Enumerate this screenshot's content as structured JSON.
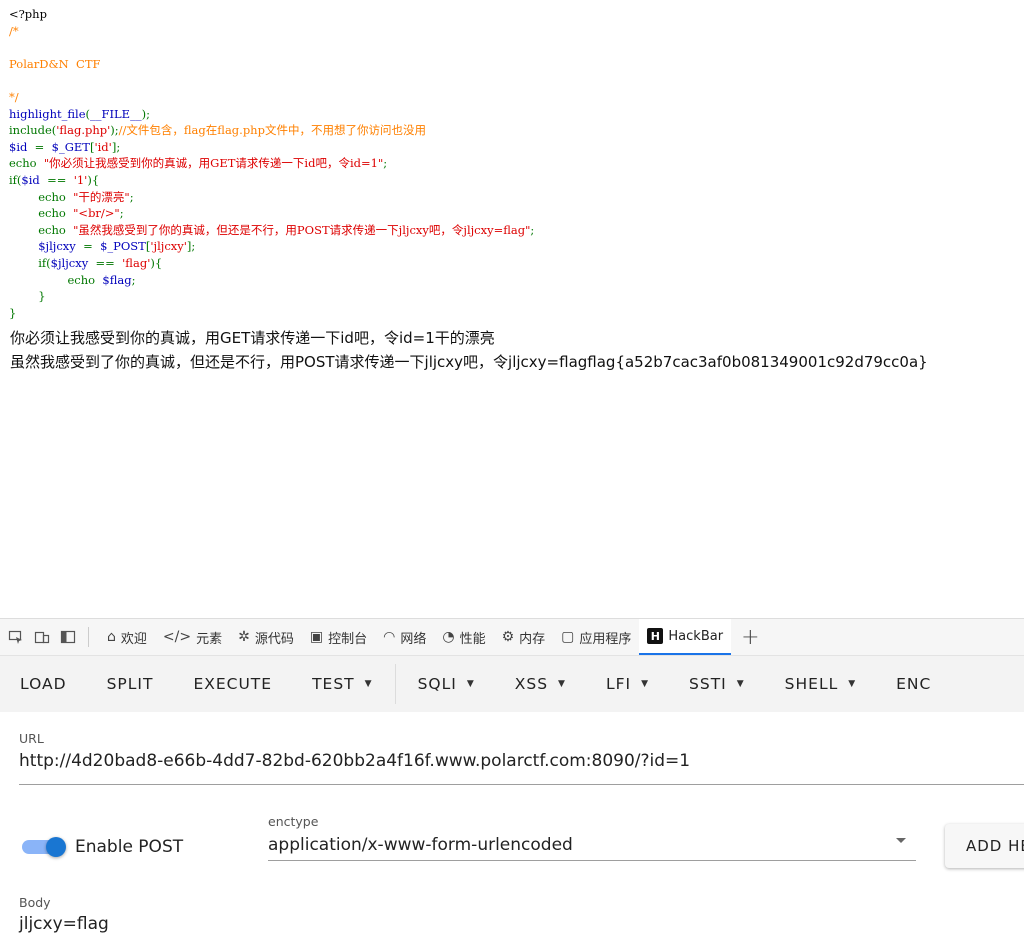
{
  "code": {
    "l1": "<?php",
    "l2": "/*",
    "l4": "PolarD&N  CTF",
    "l6": "*/",
    "l7a": "highlight_file",
    "l7b": "(",
    "l7c": "__FILE__",
    "l7d": ");",
    "l8a": "include(",
    "l8b": "'flag.php'",
    "l8c": ");",
    "l8d": "//文件包含，flag在flag.php文件中，不用想了你访问也没用",
    "l9a": "$id  ",
    "l9b": "=  ",
    "l9c": "$_GET",
    "l9d": "[",
    "l9e": "'id'",
    "l9f": "];",
    "l10a": "echo  ",
    "l10b": "\"你必须让我感受到你的真诚，用GET请求传递一下id吧，令id=1\"",
    "l10c": ";",
    "l11a": "if(",
    "l11b": "$id  ",
    "l11c": "==  ",
    "l11d": "'1'",
    "l11e": "){",
    "l12a": "        echo  ",
    "l12b": "\"干的漂亮\"",
    "l12c": ";",
    "l13a": "        echo  ",
    "l13b": "\"<br/>\"",
    "l13c": ";",
    "l14a": "        echo  ",
    "l14b": "\"虽然我感受到了你的真诚，但还是不行，用POST请求传递一下jljcxy吧，令jljcxy=flag\"",
    "l14c": ";",
    "l15a": "        $jljcxy  ",
    "l15b": "=  ",
    "l15c": "$_POST",
    "l15d": "[",
    "l15e": "'jljcxy'",
    "l15f": "];",
    "l16a": "        if(",
    "l16b": "$jljcxy  ",
    "l16c": "==  ",
    "l16d": "'flag'",
    "l16e": "){",
    "l17a": "                echo  ",
    "l17b": "$flag",
    "l17c": ";",
    "l18": "        }",
    "l19": "}"
  },
  "output": {
    "line1": "你必须让我感受到你的真诚，用GET请求传递一下id吧，令id=1干的漂亮",
    "line2": "虽然我感受到了你的真诚，但还是不行，用POST请求传递一下jljcxy吧，令jljcxy=flagflag{a52b7cac3af0b081349001c92d79cc0a}"
  },
  "devtools": {
    "tabs": [
      {
        "label": "欢迎",
        "icon": "home-icon"
      },
      {
        "label": "元素",
        "icon": "code-icon"
      },
      {
        "label": "源代码",
        "icon": "bug-icon"
      },
      {
        "label": "控制台",
        "icon": "console-icon"
      },
      {
        "label": "网络",
        "icon": "wifi-icon"
      },
      {
        "label": "性能",
        "icon": "performance-icon"
      },
      {
        "label": "内存",
        "icon": "memory-icon"
      },
      {
        "label": "应用程序",
        "icon": "application-icon"
      },
      {
        "label": "HackBar",
        "icon": "hackbar-icon",
        "active": true
      }
    ]
  },
  "hackbar": {
    "buttons": [
      "LOAD",
      "SPLIT",
      "EXECUTE",
      "TEST",
      "SQLI",
      "XSS",
      "LFI",
      "SSTI",
      "SHELL",
      "ENC"
    ],
    "url_label": "URL",
    "url_value": "http://4d20bad8-e66b-4dd7-82bd-620bb2a4f16f.www.polarctf.com:8090/?id=1",
    "enable_post_label": "Enable POST",
    "enable_post": true,
    "enctype_label": "enctype",
    "enctype_value": "application/x-www-form-urlencoded",
    "add_header_label": "ADD HEADER",
    "body_label": "Body",
    "body_value": "jljcxy=flag"
  },
  "colors": {
    "php_default": "#0000BB",
    "php_keyword": "#007700",
    "php_string": "#DD0000",
    "php_comment": "#FF8000",
    "accent": "#1976d2"
  }
}
